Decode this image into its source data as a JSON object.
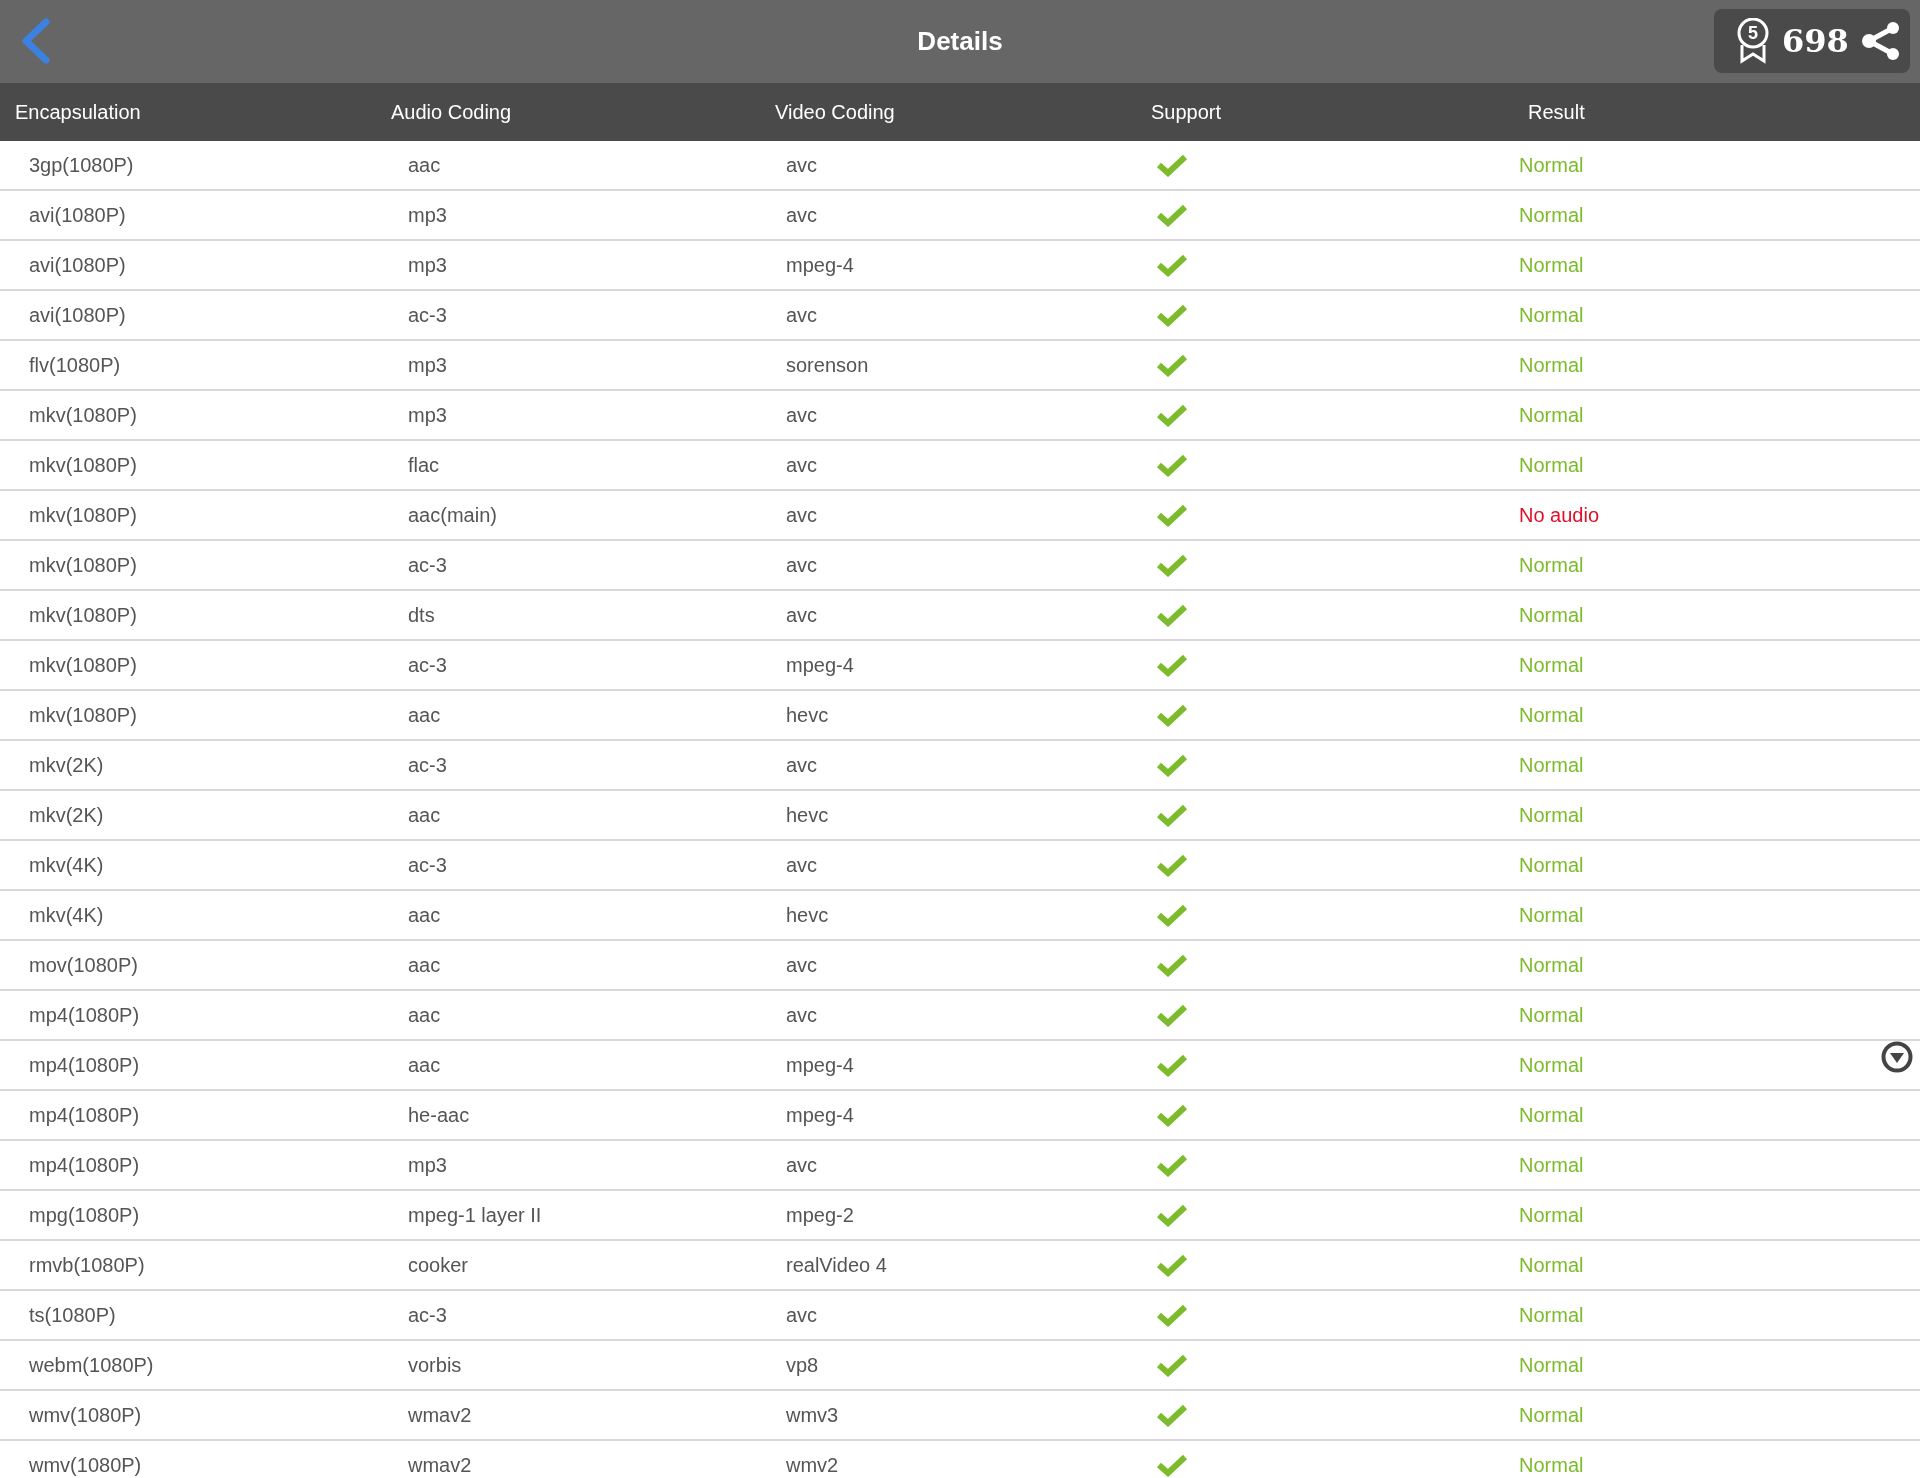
{
  "header": {
    "title": "Details",
    "badge_number": "5",
    "score": "698"
  },
  "table": {
    "columns": [
      "Encapsulation",
      "Audio Coding",
      "Video Coding",
      "Support",
      "Result"
    ],
    "rows": [
      {
        "encapsulation": "3gp(1080P)",
        "audio": "aac",
        "video": "avc",
        "supported": true,
        "result": "Normal",
        "kind": "normal"
      },
      {
        "encapsulation": "avi(1080P)",
        "audio": "mp3",
        "video": "avc",
        "supported": true,
        "result": "Normal",
        "kind": "normal"
      },
      {
        "encapsulation": "avi(1080P)",
        "audio": "mp3",
        "video": "mpeg-4",
        "supported": true,
        "result": "Normal",
        "kind": "normal"
      },
      {
        "encapsulation": "avi(1080P)",
        "audio": "ac-3",
        "video": "avc",
        "supported": true,
        "result": "Normal",
        "kind": "normal"
      },
      {
        "encapsulation": "flv(1080P)",
        "audio": "mp3",
        "video": "sorenson",
        "supported": true,
        "result": "Normal",
        "kind": "normal"
      },
      {
        "encapsulation": "mkv(1080P)",
        "audio": "mp3",
        "video": "avc",
        "supported": true,
        "result": "Normal",
        "kind": "normal"
      },
      {
        "encapsulation": "mkv(1080P)",
        "audio": "flac",
        "video": "avc",
        "supported": true,
        "result": "Normal",
        "kind": "normal"
      },
      {
        "encapsulation": "mkv(1080P)",
        "audio": "aac(main)",
        "video": "avc",
        "supported": true,
        "result": "No audio",
        "kind": "error"
      },
      {
        "encapsulation": "mkv(1080P)",
        "audio": "ac-3",
        "video": "avc",
        "supported": true,
        "result": "Normal",
        "kind": "normal"
      },
      {
        "encapsulation": "mkv(1080P)",
        "audio": "dts",
        "video": "avc",
        "supported": true,
        "result": "Normal",
        "kind": "normal"
      },
      {
        "encapsulation": "mkv(1080P)",
        "audio": "ac-3",
        "video": "mpeg-4",
        "supported": true,
        "result": "Normal",
        "kind": "normal"
      },
      {
        "encapsulation": "mkv(1080P)",
        "audio": "aac",
        "video": "hevc",
        "supported": true,
        "result": "Normal",
        "kind": "normal"
      },
      {
        "encapsulation": "mkv(2K)",
        "audio": "ac-3",
        "video": "avc",
        "supported": true,
        "result": "Normal",
        "kind": "normal"
      },
      {
        "encapsulation": "mkv(2K)",
        "audio": "aac",
        "video": "hevc",
        "supported": true,
        "result": "Normal",
        "kind": "normal"
      },
      {
        "encapsulation": "mkv(4K)",
        "audio": "ac-3",
        "video": "avc",
        "supported": true,
        "result": "Normal",
        "kind": "normal"
      },
      {
        "encapsulation": "mkv(4K)",
        "audio": "aac",
        "video": "hevc",
        "supported": true,
        "result": "Normal",
        "kind": "normal"
      },
      {
        "encapsulation": "mov(1080P)",
        "audio": "aac",
        "video": "avc",
        "supported": true,
        "result": "Normal",
        "kind": "normal"
      },
      {
        "encapsulation": "mp4(1080P)",
        "audio": "aac",
        "video": "avc",
        "supported": true,
        "result": "Normal",
        "kind": "normal"
      },
      {
        "encapsulation": "mp4(1080P)",
        "audio": "aac",
        "video": "mpeg-4",
        "supported": true,
        "result": "Normal",
        "kind": "normal"
      },
      {
        "encapsulation": "mp4(1080P)",
        "audio": "he-aac",
        "video": "mpeg-4",
        "supported": true,
        "result": "Normal",
        "kind": "normal"
      },
      {
        "encapsulation": "mp4(1080P)",
        "audio": "mp3",
        "video": "avc",
        "supported": true,
        "result": "Normal",
        "kind": "normal"
      },
      {
        "encapsulation": "mpg(1080P)",
        "audio": "mpeg-1 layer II",
        "video": "mpeg-2",
        "supported": true,
        "result": "Normal",
        "kind": "normal"
      },
      {
        "encapsulation": "rmvb(1080P)",
        "audio": "cooker",
        "video": "realVideo 4",
        "supported": true,
        "result": "Normal",
        "kind": "normal"
      },
      {
        "encapsulation": "ts(1080P)",
        "audio": "ac-3",
        "video": "avc",
        "supported": true,
        "result": "Normal",
        "kind": "normal"
      },
      {
        "encapsulation": "webm(1080P)",
        "audio": "vorbis",
        "video": "vp8",
        "supported": true,
        "result": "Normal",
        "kind": "normal"
      },
      {
        "encapsulation": "wmv(1080P)",
        "audio": "wmav2",
        "video": "wmv3",
        "supported": true,
        "result": "Normal",
        "kind": "normal"
      },
      {
        "encapsulation": "wmv(1080P)",
        "audio": "wmav2",
        "video": "wmv2",
        "supported": true,
        "result": "Normal",
        "kind": "normal"
      }
    ]
  }
}
